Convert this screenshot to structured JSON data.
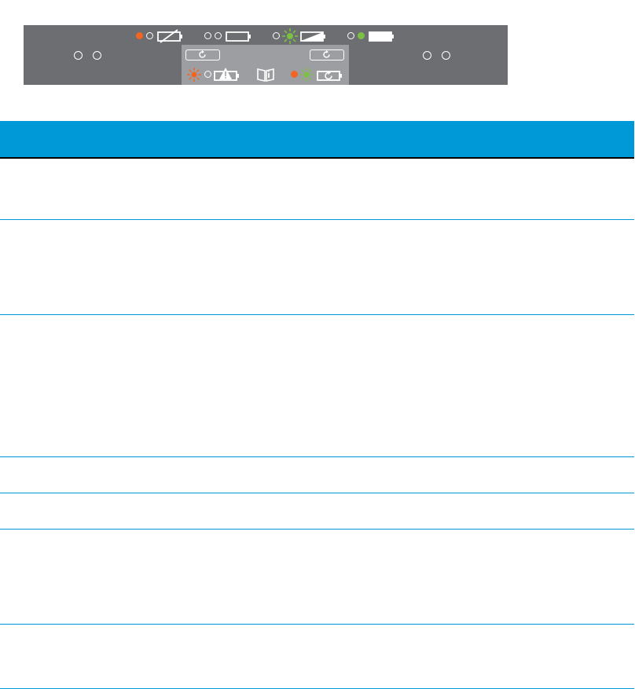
{
  "status_panel": {
    "background_color": "#6d6e71",
    "center_background_color": "#9d9ea1",
    "led_colors": {
      "orange": "#f26522",
      "green": "#7ac143",
      "off": "#ffffff"
    },
    "battery_indicators": [
      {
        "icon": "battery-disconnected-icon",
        "led1": "orange",
        "led2": "off"
      },
      {
        "icon": "battery-empty-icon",
        "led1": "off",
        "led2": "off"
      },
      {
        "icon": "battery-partial-icon",
        "led1": "off",
        "led2": "green-blinking"
      },
      {
        "icon": "battery-full-icon",
        "led1": "off",
        "led2": "green"
      }
    ],
    "lower_indicators": [
      {
        "icon": "battery-warning-icon",
        "led1": "orange-blinking",
        "led2": "off"
      },
      {
        "icon": "manual-book-icon"
      },
      {
        "icon": "battery-swap-icon",
        "led1": "orange",
        "led2": "green-blinking"
      }
    ]
  },
  "table": {
    "header_color": "#0099d8",
    "row_count": 7
  }
}
